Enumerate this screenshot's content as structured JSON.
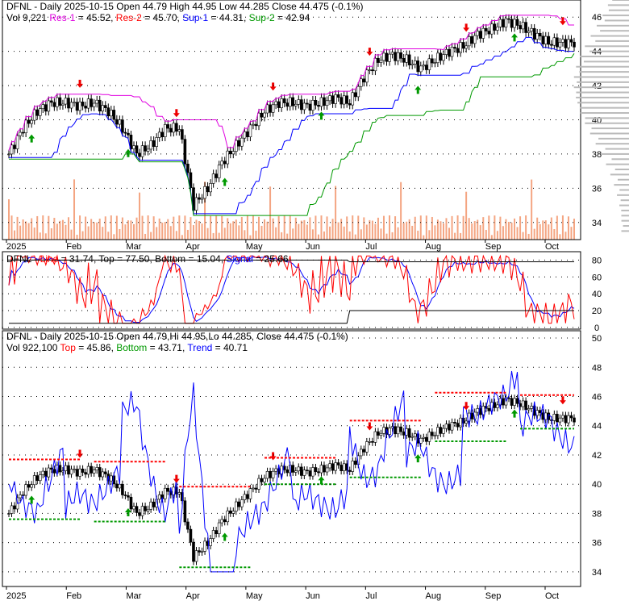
{
  "panel1": {
    "line1": "DFNL - Daily 2025-10-15 Open 44.79  High 44.95  Low 44.285  Close 44.475 (-0.1%)",
    "vol": "Vol 9,221",
    "res1": "Res-1",
    "res1_val": " = 45.52,",
    "res2": "Res-2",
    "res2_val": " = 45.70,",
    "sup1": "Sup-1",
    "sup1_val": " = 44.31,",
    "sup2": "Sup-2",
    "sup2_val": " = 42.94"
  },
  "panel2": {
    "title": "DFNL - ",
    "line": "Line",
    "line_val": " = 31.74, Top = 77.50, Bottom = 15.04, ",
    "signal": "Signal",
    "signal_val": " = 25.66"
  },
  "panel3": {
    "line1": "DFNL - Daily 2025-10-15 Open 44.79,Hi 44.95,Lo 44.285, Close 44.475 (-0.1%)",
    "vol": "Vol 922,100 ",
    "top": "Top",
    "top_val": " = 45.86, ",
    "bottom": "Bottom",
    "bottom_val": " = 43.71, ",
    "trend": "Trend",
    "trend_val": " = 40.71"
  },
  "colors": {
    "up": "#000000",
    "res1": "#e000e0",
    "res2": "#ff0000",
    "sup1": "#0000ff",
    "sup2": "#009900",
    "volume": "#f4a582",
    "profile": "#bbbbbb"
  },
  "chart_data": {
    "type": "candlestick",
    "x_labels": [
      "2025",
      "Feb",
      "Mar",
      "Apr",
      "May",
      "Jun",
      "Jul",
      "Aug",
      "Sep",
      "Oct"
    ],
    "weekly_close": [
      38,
      39.5,
      40.5,
      41,
      41,
      40.8,
      41,
      40.5,
      39.5,
      38,
      38.5,
      39.5,
      39.5,
      35,
      36,
      37.5,
      38.5,
      39.5,
      40.5,
      41,
      41,
      40.8,
      41,
      41.3,
      41,
      42.5,
      43.5,
      43.8,
      43.5,
      43,
      43.5,
      44,
      44.3,
      45,
      45.3,
      45.8,
      45.5,
      45,
      44.5,
      44.5
    ],
    "panel1_yticks": [
      34,
      36,
      38,
      40,
      42,
      44,
      46
    ],
    "panel1_ylim": [
      33,
      47
    ],
    "panel2_yticks": [
      0,
      20,
      40,
      60,
      80
    ],
    "panel2_ylim": [
      -2,
      90
    ],
    "panel3_yticks": [
      34,
      36,
      38,
      40,
      42,
      44,
      46,
      48,
      50
    ],
    "panel3_ylim": [
      33,
      50.5
    ]
  }
}
